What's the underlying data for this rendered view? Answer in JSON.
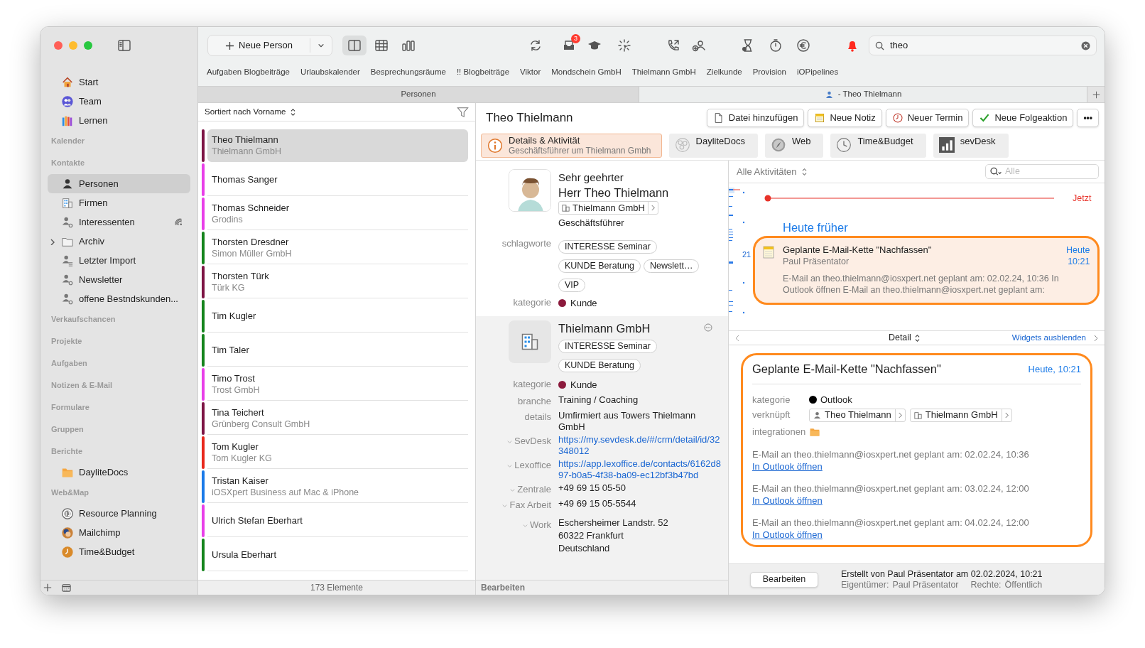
{
  "sidebar": {
    "sections": [
      {
        "items": [
          {
            "label": "Start",
            "selected": false
          },
          {
            "label": "Team",
            "selected": false
          },
          {
            "label": "Lernen",
            "selected": false
          }
        ]
      },
      {
        "heading": "Kalender"
      },
      {
        "heading": "Kontakte",
        "items": [
          {
            "label": "Personen",
            "selected": true,
            "kind": "item"
          },
          {
            "label": "Firmen",
            "selected": false,
            "kind": "item"
          },
          {
            "label": "Interessenten",
            "selected": false,
            "kind": "shared"
          },
          {
            "label": "Archiv",
            "selected": false,
            "kind": "folder"
          },
          {
            "label": "Letzter Import",
            "selected": false,
            "kind": "item"
          },
          {
            "label": "Newsletter",
            "selected": false,
            "kind": "item"
          },
          {
            "label": "offene Bestndskunden...",
            "selected": false,
            "kind": "item"
          }
        ]
      },
      {
        "heading": "Verkaufschancen"
      },
      {
        "heading": "Projekte"
      },
      {
        "heading": "Aufgaben"
      },
      {
        "heading": "Notizen & E-Mail"
      },
      {
        "heading": "Formulare"
      },
      {
        "heading": "Gruppen"
      },
      {
        "heading": "Berichte",
        "items": [
          {
            "label": "DayliteDocs",
            "selected": false
          }
        ]
      },
      {
        "heading": "Web&Map",
        "items": [
          {
            "label": "Resource Planning",
            "selected": false
          },
          {
            "label": "Mailchimp",
            "selected": false
          },
          {
            "label": "Time&Budget",
            "selected": false
          }
        ]
      }
    ]
  },
  "toolbar": {
    "new_button": "Neue Person",
    "views": [
      {
        "selected": true
      },
      {
        "selected": false
      },
      {
        "selected": false
      }
    ],
    "inbox_badge": "3",
    "search": {
      "value": "theo"
    }
  },
  "favorites": [
    "Aufgaben Blogbeiträge",
    "Urlaubskalender",
    "Besprechungsräume",
    "!! Blogbeiträge",
    "Viktor",
    "Mondschein GmbH",
    "Thielmann GmbH",
    "Zielkunde",
    "Provision",
    "iOPipelines"
  ],
  "tabs": [
    {
      "label": "Personen",
      "selected": false
    },
    {
      "label": "- Theo Thielmann",
      "selected": true
    }
  ],
  "list": {
    "sort_label": "Sortiert nach Vorname",
    "rows": [
      {
        "name": "Theo Thielmann",
        "company": "Thielmann GmbH",
        "color": "#7d1444",
        "selected": true
      },
      {
        "name": "Thomas Sanger",
        "color": "#e83ee8",
        "selected": false
      },
      {
        "name": "Thomas Schneider",
        "company": "Grodins",
        "color": "#e83ee8",
        "selected": false
      },
      {
        "name": "Thorsten Dresdner",
        "company": "Simon Müller GmbH",
        "color": "#15841c",
        "selected": false
      },
      {
        "name": "Thorsten Türk",
        "company": "Türk KG",
        "color": "#7d1444",
        "selected": false
      },
      {
        "name": "Tim Kugler",
        "color": "#15841c",
        "selected": false
      },
      {
        "name": "Tim Taler",
        "color": "#15841c",
        "selected": false
      },
      {
        "name": "Timo Trost",
        "company": "Trost GmbH",
        "color": "#e83ee8",
        "selected": false
      },
      {
        "name": "Tina Teichert",
        "company": "Grünberg Consult GmbH",
        "color": "#7d1444",
        "selected": false
      },
      {
        "name": "Tom Kugler",
        "company": "Tom Kugler KG",
        "color": "#e8281c",
        "selected": false
      },
      {
        "name": "Tristan Kaiser",
        "company": "iOSXpert Business auf Mac & iPhone",
        "color": "#1a7ae8",
        "selected": false
      },
      {
        "name": "Ulrich Stefan Eberhart",
        "color": "#e83ee8",
        "selected": false
      },
      {
        "name": "Ursula Eberhart",
        "color": "#15841c",
        "selected": false
      }
    ],
    "count": "173 Elemente"
  },
  "detail": {
    "title": "Theo Thielmann",
    "actions": [
      "Datei hinzufügen",
      "Neue Notiz",
      "Neuer Termin",
      "Neue Folgeaktion"
    ],
    "more": "•••",
    "widgets": [
      {
        "label": "Details & Aktivität",
        "subtitle": "Geschäftsführer um Thielmann Gmbh",
        "selected": true
      },
      {
        "label": "DayliteDocs",
        "selected": false
      },
      {
        "label": "Web",
        "selected": false
      },
      {
        "label": "Time&Budget",
        "selected": false
      },
      {
        "label": "sevDesk",
        "selected": false
      }
    ],
    "person": {
      "salutation": "Sehr geehrter",
      "name": "Herr Theo Thielmann",
      "company": "Thielmann GmbH",
      "role": "Geschäftsführer",
      "fields": [
        {
          "label": "schlagworte",
          "kind": "tags",
          "tags": [
            "INTERESSE Seminar",
            "KUNDE Beratung",
            "Newslett…",
            "VIP"
          ]
        },
        {
          "label": "kategorie",
          "kind": "category",
          "value": "Kunde",
          "color": "#8b1a3c"
        }
      ]
    },
    "company": {
      "name": "Thielmann GmbH",
      "tags": [
        "INTERESSE Seminar",
        "KUNDE Beratung"
      ],
      "fields": [
        {
          "label": "kategorie",
          "kind": "category",
          "value": "Kunde",
          "color": "#8b1a3c",
          "collapsible": false
        },
        {
          "label": "branche",
          "kind": "text",
          "value": "Training / Coaching",
          "collapsible": false
        },
        {
          "label": "details",
          "kind": "text",
          "value": "Umfirmiert aus Towers Thielmann GmbH",
          "collapsible": false
        },
        {
          "label": "SevDesk",
          "kind": "link",
          "value": "https://my.sevdesk.de/#/crm/detail/id/32348012",
          "collapsible": true
        },
        {
          "label": "Lexoffice",
          "kind": "link",
          "value": "https://app.lexoffice.de/contacts/6162d897-b0a5-4f38-ba09-ec12bf3b47bd",
          "collapsible": true
        },
        {
          "label": "Zentrale",
          "kind": "text",
          "value": "+49 69 15 05-50",
          "collapsible": true
        },
        {
          "label": "Fax Arbeit",
          "kind": "text",
          "value": "+49 69 15 05-5544",
          "collapsible": true
        },
        {
          "label": "Work",
          "kind": "address",
          "lines": [
            "Eschersheimer Landstr. 52",
            "60322 Frankfurt",
            "Deutschland"
          ],
          "collapsible": true
        }
      ]
    },
    "footer": "Bearbeiten"
  },
  "activity": {
    "filter": "Alle Aktivitäten",
    "search": {
      "placeholder": "Alle"
    },
    "now_label": "Jetzt",
    "section": "Heute früher",
    "day": "21",
    "card": {
      "title": "Geplante E-Mail-Kette \"Nachfassen\"",
      "owner": "Paul Präsentator",
      "date": "Heute",
      "time": "10:21",
      "snippet": "E-Mail an theo.thielmann@iosxpert.net geplant am: 02.02.24, 10:36 In Outlook öffnen E-Mail an theo.thielmann@iosxpert.net geplant am:"
    },
    "detail_bar": {
      "label": "Detail",
      "hide_link": "Widgets ausblenden"
    },
    "detail": {
      "title": "Geplante E-Mail-Kette \"Nachfassen\"",
      "date": "Heute, 10:21",
      "category": {
        "label": "kategorie",
        "value": "Outlook",
        "color": "#000000"
      },
      "links_label": "verknüpft",
      "links": [
        "Theo Thielmann",
        "Thielmann GmbH"
      ],
      "integrations_label": "integrationen",
      "emails": [
        {
          "text": "E-Mail an theo.thielmann@iosxpert.net geplant am: 02.02.24, 10:36",
          "link": "In Outlook öffnen"
        },
        {
          "text": "E-Mail an theo.thielmann@iosxpert.net geplant am: 03.02.24, 12:00",
          "link": "In Outlook öffnen"
        },
        {
          "text": "E-Mail an theo.thielmann@iosxpert.net geplant am: 04.02.24, 12:00",
          "link": "In Outlook öffnen"
        }
      ]
    },
    "footer": {
      "button": "Bearbeiten",
      "created": "Erstellt von Paul Präsentator am 02.02.2024, 10:21",
      "owner_label": "Eigentümer:",
      "owner": "Paul Präsentator",
      "rights_label": "Rechte:",
      "rights": "Öffentlich"
    }
  }
}
